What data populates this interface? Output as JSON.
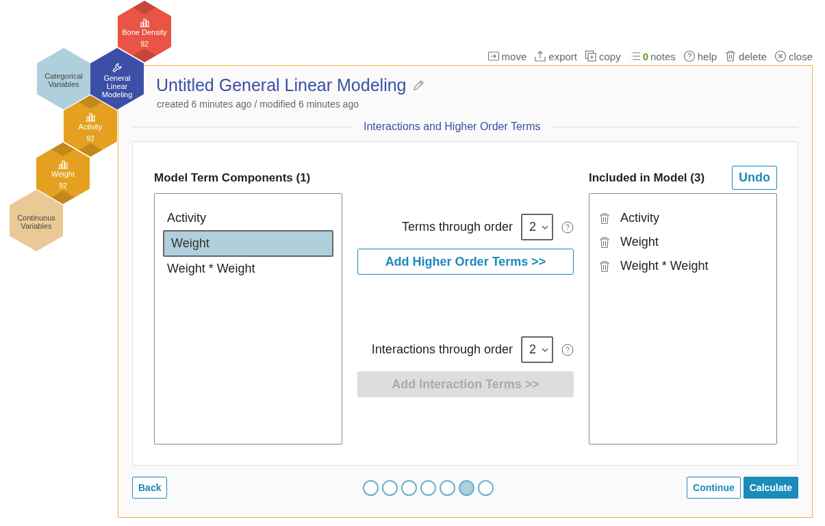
{
  "hexagons": [
    {
      "kind": "variable",
      "label": "Bone Density",
      "count": "92",
      "color": "#e95444"
    },
    {
      "kind": "category",
      "label": "Categorical Variables",
      "color": "#aecfdb"
    },
    {
      "kind": "analysis",
      "label": "General Linear Modeling",
      "color": "#3c4fa6"
    },
    {
      "kind": "variable",
      "label": "Activity",
      "count": "92",
      "color": "#e5a020"
    },
    {
      "kind": "variable",
      "label": "Weight",
      "count": "92",
      "color": "#e5a020"
    },
    {
      "kind": "category",
      "label": "Continuous Variables",
      "color": "#ebc996"
    }
  ],
  "toolbar": [
    {
      "kind": "move",
      "label": "move"
    },
    {
      "kind": "export",
      "label": "export"
    },
    {
      "kind": "copy",
      "label": "copy"
    },
    {
      "kind": "notes",
      "label": "notes",
      "count": "0"
    },
    {
      "kind": "help",
      "label": "help"
    },
    {
      "kind": "delete",
      "label": "delete"
    },
    {
      "kind": "close",
      "label": "close"
    }
  ],
  "title": "Untitled General Linear Modeling",
  "subtitle": "created 6 minutes ago / modified 6 minutes ago",
  "section": "Interactions and Higher Order Terms",
  "components": {
    "heading": "Model Term Components (1)",
    "items": [
      {
        "label": "Activity",
        "selected": false
      },
      {
        "label": "Weight",
        "selected": true
      },
      {
        "label": "Weight * Weight",
        "selected": false
      }
    ]
  },
  "terms": {
    "label": "Terms through order",
    "value": "2",
    "button": "Add Higher Order Terms >>",
    "disabled": false
  },
  "interactions": {
    "label": "Interactions through order",
    "value": "2",
    "button": "Add Interaction Terms >>",
    "disabled": true
  },
  "included": {
    "heading": "Included in Model (3)",
    "undo": "Undo",
    "items": [
      "Activity",
      "Weight",
      "Weight * Weight"
    ]
  },
  "footer": {
    "back": "Back",
    "steps": [
      {
        "selected": false
      },
      {
        "selected": false
      },
      {
        "selected": false
      },
      {
        "selected": false
      },
      {
        "selected": false
      },
      {
        "selected": true
      },
      {
        "selected": false
      }
    ],
    "continue": "Continue",
    "calculate": "Calculate"
  }
}
